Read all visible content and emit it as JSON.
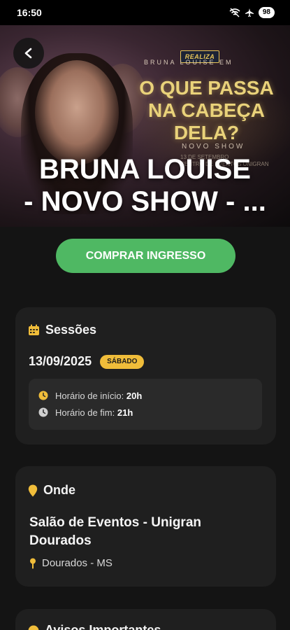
{
  "status_bar": {
    "time": "16:50",
    "battery": "98"
  },
  "hero": {
    "logo_text": "REALIZA",
    "poster_small": "BRUNA LOUISE EM",
    "poster_title": "O QUE PASSA NA CABEÇA DELA?",
    "poster_subtitle": "NOVO SHOW",
    "poster_date_line1": "13 DE SETEMBRO",
    "poster_date_line2": "CENTRO DE EVENTOS UNIGRAN",
    "event_title_line1": "BRUNA LOUISE",
    "event_title_line2": "- NOVO SHOW - ..."
  },
  "buy_button": {
    "label": "COMPRAR INGRESSO"
  },
  "sessions": {
    "title": "Sessões",
    "date": "13/09/2025",
    "day_badge": "SÁBADO",
    "start_label": "Horário de início: ",
    "start_value": "20h",
    "end_label": "Horário de fim: ",
    "end_value": "21h"
  },
  "where": {
    "title": "Onde",
    "venue": "Salão de Eventos - Unigran Dourados",
    "city": "Dourados - MS"
  },
  "notices": {
    "title": "Avisos Importantes"
  },
  "colors": {
    "accent": "#f0bd3a",
    "buy_button": "#4fb863",
    "card_bg": "#1f1f1f",
    "page_bg": "#141414"
  }
}
